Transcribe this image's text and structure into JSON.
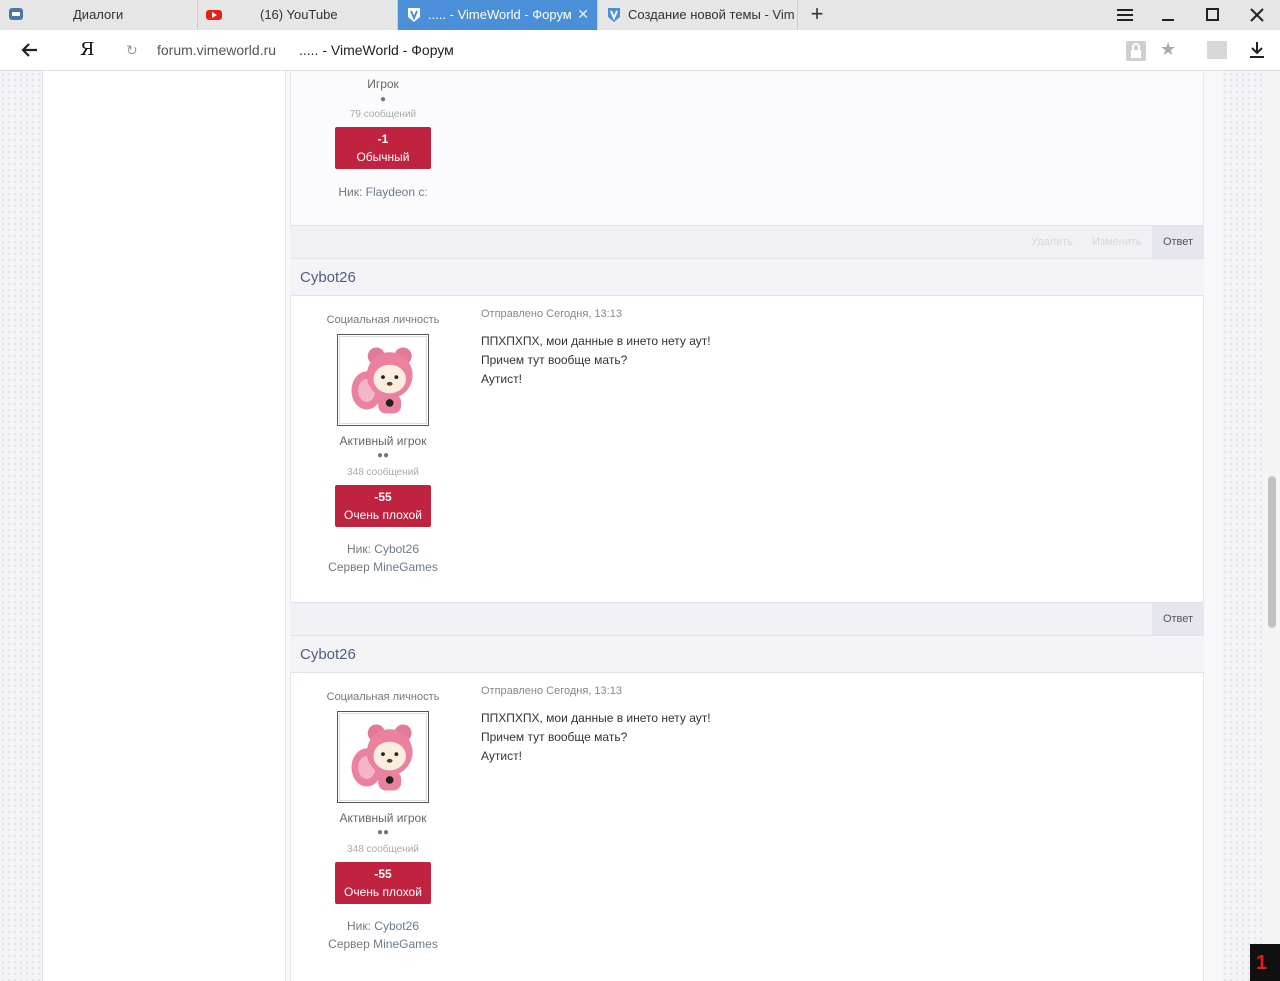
{
  "browser": {
    "tabs": [
      {
        "title": "Диалоги",
        "icon": "chat-icon"
      },
      {
        "title": "(16) YouTube",
        "icon": "youtube-icon"
      },
      {
        "title": "..... - VimeWorld - Форум",
        "icon": "vimeworld-icon",
        "active": true
      },
      {
        "title": "Создание новой темы - Vim",
        "icon": "vimeworld-icon"
      }
    ],
    "new_tab": "+",
    "address": {
      "logo": "Я",
      "domain": "forum.vimeworld.ru",
      "page_title": "..... - VimeWorld - Форум"
    }
  },
  "post_partial": {
    "rank": "Игрок",
    "pips": "●",
    "post_count": "79 сообщений",
    "reputation_value": "-1",
    "reputation_label": "Обычный",
    "nick_label": "Ник:",
    "nick_value": "Flaydeon c:"
  },
  "post_partial_actions": {
    "delete": "Удалить",
    "edit": "Изменить",
    "reply": "Ответ"
  },
  "posts": [
    {
      "username": "Cybot26",
      "user_title": "Социальная личность",
      "rank": "Активный игрок",
      "pips": "●●",
      "post_count": "348 сообщений",
      "reputation_value": "-55",
      "reputation_label": "Очень плохой",
      "nick_label": "Ник:",
      "nick_value": "Cybot26",
      "server_label": "Сервер",
      "server_value": "MineGames",
      "date": "Отправлено Сегодня, 13:13",
      "lines": [
        "ППХПХПХ, мои данные в инето нету аут!",
        "Причем тут вообще мать?",
        "Аутист!"
      ],
      "reply": "Ответ"
    },
    {
      "username": "Cybot26",
      "user_title": "Социальная личность",
      "rank": "Активный игрок",
      "pips": "●●",
      "post_count": "348 сообщений",
      "reputation_value": "-55",
      "reputation_label": "Очень плохой",
      "nick_label": "Ник:",
      "nick_value": "Cybot26",
      "server_label": "Сервер",
      "server_value": "MineGames",
      "date": "Отправлено Сегодня, 13:13",
      "lines": [
        "ППХПХПХ, мои данные в инето нету аут!",
        "Причем тут вообще мать?",
        "Аутист!"
      ]
    }
  ],
  "corner_badge": "1",
  "colors": {
    "active_tab": "#4a8fd8",
    "reputation_bad": "#c0233f",
    "username": "#4f5d7f"
  }
}
